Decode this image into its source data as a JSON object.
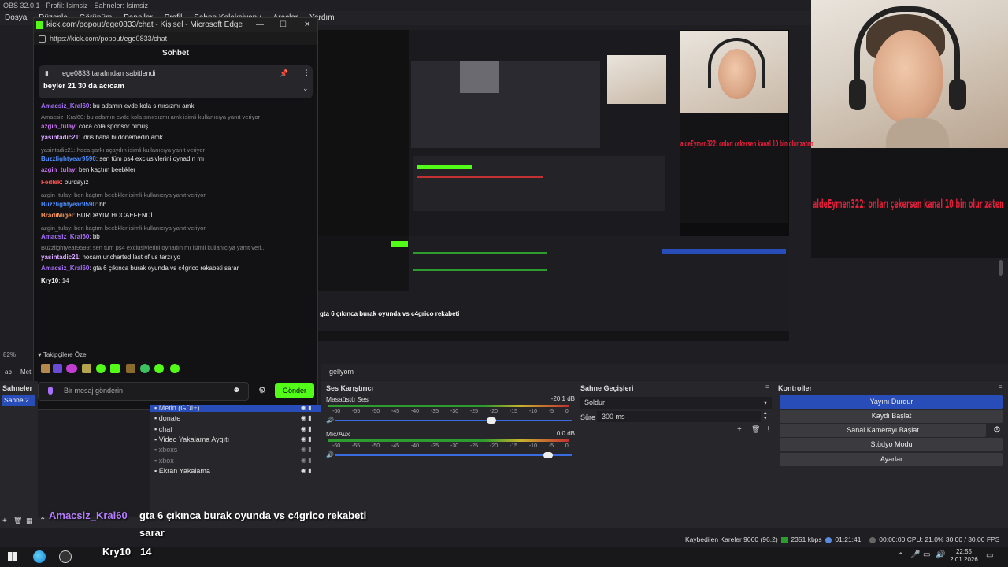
{
  "obs": {
    "title": "OBS 32.0.1 - Profil: İsimsiz - Sahneler: İsimsiz",
    "menu": [
      "Dosya",
      "Düzenle",
      "Görünüm",
      "Paneller",
      "Profil",
      "Sahne Koleksiyonu",
      "Araçlar",
      "Yardım"
    ],
    "sahneler_title": "Sahneler",
    "sahne_item": "Sahne 2",
    "sources": [
      {
        "label": "Metin (GDI+)"
      },
      {
        "label": "donate"
      },
      {
        "label": "chat"
      },
      {
        "label": "Video Yakalama Aygıtı"
      },
      {
        "label": "xboxs"
      },
      {
        "label": "xbox"
      },
      {
        "label": "Ekran Yakalama"
      }
    ],
    "scene_label_tab": "gellyom",
    "mixer": {
      "title": "Ses Karıştırıcı",
      "channels": [
        {
          "name": "Masaüstü Ses",
          "db": "-20.1 dB",
          "level": 0.66
        },
        {
          "name": "Mic/Aux",
          "db": "0.0 dB",
          "level": 0.9
        }
      ],
      "ticks": [
        "-60",
        "-55",
        "-50",
        "-45",
        "-40",
        "-35",
        "-30",
        "-25",
        "-20",
        "-15",
        "-10",
        "-5",
        "0"
      ]
    },
    "transitions": {
      "title": "Sahne Geçişleri",
      "selected": "Soldur",
      "duration_label": "Süre",
      "duration": "300 ms"
    },
    "controls": {
      "title": "Kontroller",
      "buttons": [
        "Yayını Durdur",
        "Kaydı Başlat",
        "Sanal Kamerayı Başlat",
        "Stüdyo Modu",
        "Ayarlar"
      ]
    },
    "status": {
      "dropped": "Kaybedilen Kareler 9060 (96.2)",
      "bitrate": "2351 kbps",
      "live_time": "01:21:41",
      "rec_time": "00:00:00",
      "cpu": "CPU: 21.0% 30.00 / 30.00 FPS"
    },
    "zoom": "82%",
    "tab_a": "ab",
    "tab_b": "Met"
  },
  "edge": {
    "title": "kick.com/popout/ege0833/chat - Kişisel - Microsoft Edge",
    "url": "https://kick.com/popout/ege0833/chat"
  },
  "chat": {
    "header": "Sohbet",
    "pinned_by": "ege0833 tarafından sabitlendi",
    "pinned_msg": "beyler 21 30 da acıcam",
    "messages": [
      {
        "user": "Amacsiz_Kral60",
        "text": ": bu adamın evde kola sınırsızmı amk",
        "color": "#a970ff",
        "reply": ""
      },
      {
        "user": "",
        "text": "",
        "color": "#888",
        "reply": "Amacsiz_Kral60: bu adamın evde kola sınırsızmı amk isimli kullanıcıya yanıt veriyor"
      },
      {
        "user": "azgin_tulay",
        "text": ": coca cola sponsor olmuş",
        "color": "#c471ed",
        "reply": ""
      },
      {
        "user": "yasintadic21",
        "text": ": idris baba bi dönemedin amk",
        "color": "#d7a6ff",
        "reply": ""
      },
      {
        "user": "",
        "text": "",
        "color": "#888",
        "reply": "yasintadic21: hoca şarkı açaydın isimli kullanıcıya yanıt veriyor"
      },
      {
        "user": "Buzzlightyear9590",
        "text": ": sen tüm ps4 exclusivlerini oynadın mı",
        "color": "#4c8dff",
        "reply": ""
      },
      {
        "user": "azgin_tulay",
        "text": ": ben kaçtım beebkler",
        "color": "#c471ed",
        "reply": ""
      },
      {
        "user": "Fedlek",
        "text": ": burdayız",
        "color": "#ff5555",
        "reply": ""
      },
      {
        "user": "",
        "text": "",
        "color": "#888",
        "reply": "azgin_tulay: ben kaçtım beebkler isimli kullanıcıya yanıt veriyor"
      },
      {
        "user": "Buzzlightyear9590",
        "text": ": bb",
        "color": "#4c8dff",
        "reply": ""
      },
      {
        "user": "BradiMigel",
        "text": ": BURDAYIM HOCAEFENDİ",
        "color": "#ff9b5e",
        "reply": ""
      },
      {
        "user": "",
        "text": "",
        "color": "#888",
        "reply": "azgin_tulay: ben kaçtım beebkler isimli kullanıcıya yanıt veriyor"
      },
      {
        "user": "Amacsiz_Kral60",
        "text": ": bb",
        "color": "#a970ff",
        "reply": ""
      },
      {
        "user": "",
        "text": "",
        "color": "#888",
        "reply": "Buzzlightyear9599: sen tüm ps4 exclusivlerini oynadın mı isimli kullanıcıya yanıt veri..."
      },
      {
        "user": "yasintadic21",
        "text": ": hocam uncharted last of us tarzı yo",
        "color": "#d7a6ff",
        "reply": ""
      },
      {
        "user": "Amacsiz_Kral60",
        "text": ": gta 6 çıkınca burak oyunda vs c4grico rekabeti sarar",
        "color": "#a970ff",
        "reply": ""
      },
      {
        "user": "Kry10",
        "text": ": 14",
        "color": "#ffffff",
        "reply": ""
      }
    ],
    "followers": "Takipçilere Özel",
    "input_placeholder": "Bir mesaj gönderin",
    "send": "Gönder"
  },
  "overlay": {
    "red_text": "aldeEymen322: onları çekersen kanal 10 bin olur zaten",
    "preview_caption": "gta 6 çıkınca burak oyunda vs c4grico rekabeti",
    "sub_user": "Amacsiz_Kral60",
    "sub_text": "gta 6 çıkınca burak oyunda vs c4grico rekabeti",
    "sub_text2": "sarar",
    "sub2_user": "Kry10",
    "sub2_text": "14"
  },
  "taskbar": {
    "time": "22:55",
    "date": "2.01.2026"
  },
  "colors": {
    "kick_green": "#53fc18",
    "obs_blue": "#284cb8",
    "red_overlay": "#e0203a"
  }
}
